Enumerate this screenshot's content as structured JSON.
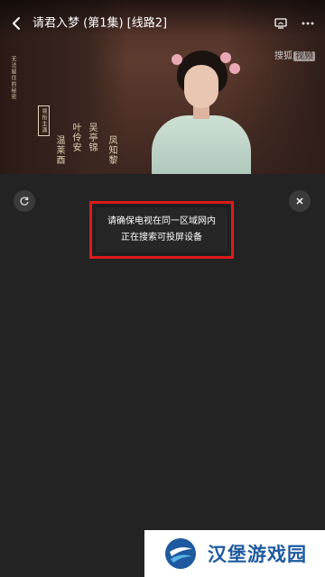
{
  "header": {
    "title": "请君入梦 (第1集) [线路2]",
    "back_icon": "chevron-left-icon",
    "cast_icon": "tv-cast-icon",
    "more_icon": "more-dots-icon"
  },
  "video": {
    "watermark_part1": "搜狐",
    "watermark_part2": "视频",
    "credits": {
      "small_line": "无法留住的秘密",
      "stamp": "领衔主演",
      "col1": "温莱酉",
      "col2": "叶伶安",
      "col3": "吴亭锦",
      "col4": "凤知黎"
    }
  },
  "cast_panel": {
    "refresh_icon": "refresh-icon",
    "close_icon": "close-icon",
    "message_line1": "请确保电视在同一区域网内",
    "message_line2": "正在搜索可投屏设备",
    "highlight_color": "#e01b1b"
  },
  "footer": {
    "brand_name": "汉堡游戏园",
    "brand_color": "#1e5aa0"
  }
}
